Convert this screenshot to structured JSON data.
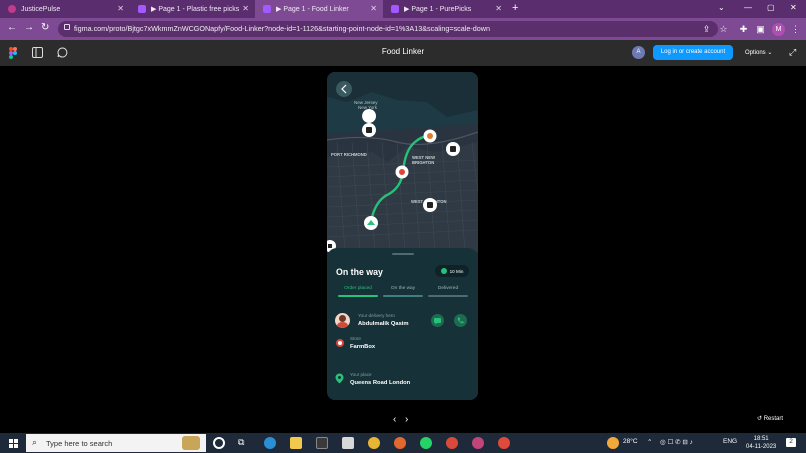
{
  "browser": {
    "tabs": [
      {
        "label": "JusticePulse",
        "active": false,
        "favicon_color": "#c23a8a"
      },
      {
        "label": "▶ Page 1 - Plastic free picks",
        "active": false,
        "favicon_color": "#a259ff"
      },
      {
        "label": "▶ Page 1 - Food Linker",
        "active": true,
        "favicon_color": "#a259ff"
      },
      {
        "label": "▶ Page 1 - PurePicks",
        "active": false,
        "favicon_color": "#a259ff"
      }
    ],
    "url": "figma.com/proto/Bjtgc7xWkmmZnWCGONapfy/Food-Linker?node-id=1-1126&starting-point-node-id=1%3A13&scaling=scale-down",
    "profile_initial": "M"
  },
  "figma": {
    "title": "Food Linker",
    "user_initial": "A",
    "login_label": "Log in or create account",
    "options_label": "Options ⌄"
  },
  "app": {
    "map_labels": {
      "new_jersey": "New Jersey",
      "new_york": "New York",
      "port_richmond": "PORT RICHMOND",
      "west_new": "WEST NEW",
      "brighton": "BRIGHTON",
      "west_brighton": "WEST BRIGHTON"
    },
    "status_title": "On the way",
    "eta": "10 Min",
    "steps": [
      {
        "label": "Order placed",
        "state": "done"
      },
      {
        "label": "On the way",
        "state": "active"
      },
      {
        "label": "Delivered",
        "state": "pending"
      }
    ],
    "hero_label": "Your delivery hero",
    "hero_name": "Abdulmalik Qasim",
    "store_label": "Store",
    "store_name": "FarmBox",
    "place_label": "Your place",
    "place_name": "Queens Road London"
  },
  "prototype": {
    "restart_label": "Restart"
  },
  "taskbar": {
    "search_placeholder": "Type here to search",
    "weather": "28°C",
    "language": "ENG",
    "time": "18:51",
    "date": "04-11-2023"
  }
}
